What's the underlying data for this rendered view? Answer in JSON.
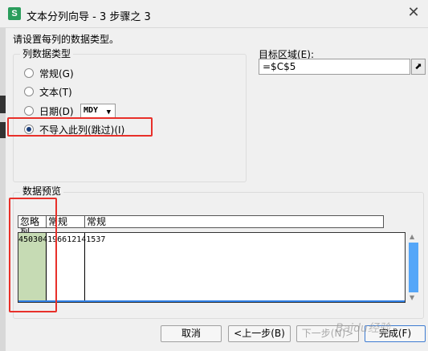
{
  "window": {
    "title": "文本分列向导 - 3 步骤之 3",
    "app_icon_letter": "S",
    "close_glyph": "✕"
  },
  "instruction": "请设置每列的数据类型。",
  "column_type_group": {
    "label": "列数据类型",
    "options": [
      {
        "label": "常规(G)",
        "selected": false
      },
      {
        "label": "文本(T)",
        "selected": false
      },
      {
        "label": "日期(D)",
        "selected": false
      },
      {
        "label": "不导入此列(跳过)(I)",
        "selected": true
      }
    ],
    "date_format": "MDY"
  },
  "target_area": {
    "label": "目标区域(E):",
    "value": "=$C$5"
  },
  "preview": {
    "label": "数据预览",
    "headers": [
      "忽略列",
      "常规",
      "常规"
    ],
    "row1": "450304196612141537"
  },
  "buttons": {
    "cancel": "取消",
    "back": "<上一步(B)",
    "next": "下一步(N)>",
    "finish": "完成(F)"
  },
  "watermark": "Baidu经验",
  "colors": {
    "highlight": "#e8302a",
    "accent": "#55a6f8",
    "skipped_column": "#c6dbb4"
  }
}
